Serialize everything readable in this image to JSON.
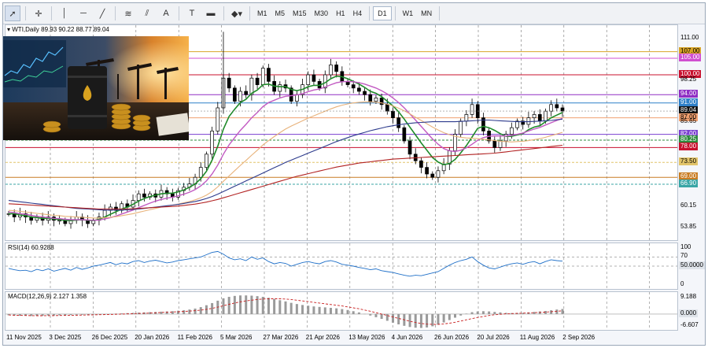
{
  "toolbar": {
    "tools": [
      {
        "name": "cursor-icon",
        "glyph": "➚",
        "selected": true
      },
      {
        "name": "crosshair-icon",
        "glyph": "✛",
        "selected": false
      },
      {
        "name": "vertical-line-icon",
        "glyph": "│",
        "selected": false
      },
      {
        "name": "horizontal-line-icon",
        "glyph": "─",
        "selected": false
      },
      {
        "name": "trend-line-icon",
        "glyph": "╱",
        "selected": false
      },
      {
        "name": "fibonacci-icon",
        "glyph": "≋",
        "selected": false
      },
      {
        "name": "channel-icon",
        "glyph": "⫽",
        "selected": false
      },
      {
        "name": "text-icon",
        "glyph": "A",
        "selected": false
      },
      {
        "name": "label-icon",
        "glyph": "T",
        "selected": false
      },
      {
        "name": "rectangle-icon",
        "glyph": "▬",
        "selected": false
      },
      {
        "name": "shapes-dropdown-icon",
        "glyph": "◆▾",
        "selected": false
      }
    ],
    "timeframes": [
      "M1",
      "M5",
      "M15",
      "M30",
      "H1",
      "H4",
      "D1",
      "W1",
      "MN"
    ],
    "selected_timeframe": "D1"
  },
  "chart": {
    "header": "WTI,Daily  89.93 90.22 88.77 89.04",
    "price_labels": [
      {
        "value": "111.00",
        "y": 111.0,
        "bg": "",
        "fg": "#000"
      },
      {
        "value": "107.00",
        "y": 107.0,
        "bg": "#d8a427",
        "fg": "#000"
      },
      {
        "value": "105.00",
        "y": 105.0,
        "bg": "#d04fd0",
        "fg": "#fff"
      },
      {
        "value": "100.00",
        "y": 100.0,
        "bg": "#c8102e",
        "fg": "#fff"
      },
      {
        "value": "98.25",
        "y": 98.25,
        "bg": "",
        "fg": "#000"
      },
      {
        "value": "94.00",
        "y": 94.0,
        "bg": "#8f2fc4",
        "fg": "#fff"
      },
      {
        "value": "91.00",
        "y": 91.5,
        "bg": "#2f80c8",
        "fg": "#fff"
      },
      {
        "value": "89.04",
        "y": 89.04,
        "bg": "#111111",
        "fg": "#fff"
      },
      {
        "value": "87.00",
        "y": 87.0,
        "bg": "#f0a070",
        "fg": "#000"
      },
      {
        "value": "85.65",
        "y": 85.65,
        "bg": "",
        "fg": "#000"
      },
      {
        "value": "82.00",
        "y": 82.0,
        "bg": "#7a3fd0",
        "fg": "#fff"
      },
      {
        "value": "80.25",
        "y": 80.25,
        "bg": "#2e8b3d",
        "fg": "#fff"
      },
      {
        "value": "78.00",
        "y": 78.0,
        "bg": "#c8102e",
        "fg": "#fff"
      },
      {
        "value": "73.50",
        "y": 73.5,
        "bg": "#e2c46a",
        "fg": "#000"
      },
      {
        "value": "69.00",
        "y": 69.0,
        "bg": "#c97d24",
        "fg": "#fff"
      },
      {
        "value": "66.90",
        "y": 66.9,
        "bg": "#3aa6a6",
        "fg": "#fff"
      },
      {
        "value": "60.15",
        "y": 60.15,
        "bg": "",
        "fg": "#000"
      },
      {
        "value": "53.85",
        "y": 53.85,
        "bg": "",
        "fg": "#000"
      }
    ],
    "levels": [
      {
        "y": 107.0,
        "color": "#d8a427",
        "style": "solid"
      },
      {
        "y": 105.0,
        "color": "#d04fd0",
        "style": "solid"
      },
      {
        "y": 100.0,
        "color": "#c8102e",
        "style": "solid"
      },
      {
        "y": 94.0,
        "color": "#8f2fc4",
        "style": "solid"
      },
      {
        "y": 91.5,
        "color": "#2f80c8",
        "style": "solid"
      },
      {
        "y": 87.0,
        "color": "#f0a070",
        "style": "solid"
      },
      {
        "y": 82.0,
        "color": "#7a3fd0",
        "style": "solid"
      },
      {
        "y": 80.25,
        "color": "#2e8b3d",
        "style": "dash"
      },
      {
        "y": 78.0,
        "color": "#c8102e",
        "style": "solid"
      },
      {
        "y": 73.5,
        "color": "#e2c46a",
        "style": "dash"
      },
      {
        "y": 69.0,
        "color": "#c97d24",
        "style": "solid"
      },
      {
        "y": 66.9,
        "color": "#3aa6a6",
        "style": "dash"
      }
    ],
    "x_labels": [
      "11 Nov 2025",
      "3 Dec 2025",
      "26 Dec 2025",
      "20 Jan 2026",
      "11 Feb 2026",
      "5 Mar 2026",
      "27 Mar 2026",
      "21 Apr 2026",
      "13 May 2026",
      "4 Jun 2026",
      "26 Jun 2026",
      "20 Jul 2026",
      "11 Aug 2026",
      "2 Sep 2026"
    ]
  },
  "chart_data": {
    "type": "line",
    "title": "WTI,Daily",
    "ylim": [
      50,
      115
    ],
    "ohlc": {
      "open": 89.93,
      "high": 90.22,
      "low": 88.77,
      "close": 89.04
    },
    "series": [
      {
        "name": "close",
        "values": [
          58,
          57,
          58,
          57,
          56,
          57,
          56,
          57,
          56,
          56,
          55,
          56,
          57,
          56,
          55,
          56,
          57,
          59,
          60,
          59,
          61,
          60,
          62,
          64,
          63,
          64,
          63,
          65,
          64,
          63,
          65,
          66,
          67,
          69,
          72,
          76,
          83,
          90,
          99,
          96,
          92,
          95,
          94,
          99,
          97,
          102,
          98,
          95,
          97,
          96,
          92,
          94,
          97,
          100,
          98,
          96,
          100,
          103,
          101,
          98,
          97,
          96,
          95,
          94,
          92,
          93,
          91,
          89,
          87,
          84,
          80,
          76,
          74,
          72,
          70,
          69,
          71,
          73,
          77,
          82,
          86,
          88,
          91,
          87,
          83,
          80,
          78,
          80,
          82,
          84,
          86,
          85,
          87,
          88,
          86,
          89,
          91,
          90,
          89.04
        ]
      },
      {
        "name": "ma-green",
        "values": [
          58,
          58,
          57.6,
          57.4,
          57,
          56.8,
          56.6,
          56.6,
          56.4,
          56.2,
          56,
          55.9,
          56.1,
          56.2,
          56,
          55.9,
          56.3,
          57,
          57.8,
          58.6,
          59.4,
          60,
          60.8,
          61.8,
          62.6,
          63.2,
          63.6,
          64,
          64.2,
          64.2,
          64.6,
          65.2,
          66,
          67,
          68.6,
          70.8,
          74.2,
          78.4,
          83.6,
          87.4,
          89.6,
          91.6,
          92.6,
          94.4,
          95.4,
          97,
          97.2,
          96.6,
          96.4,
          96.4,
          95.6,
          95.2,
          95.6,
          96.4,
          96.8,
          96.8,
          97.6,
          98.8,
          99.6,
          99.4,
          98.8,
          98,
          97.2,
          96.2,
          95,
          94.4,
          93.4,
          92,
          90.6,
          88.8,
          86.6,
          84.2,
          81.8,
          79.4,
          77.2,
          75,
          73.6,
          72.8,
          73.2,
          74.4,
          76.4,
          78.6,
          81.2,
          83.8,
          84.4,
          84,
          83.2,
          82.2,
          81.4,
          81.4,
          81.8,
          82.2,
          83.4,
          84.2,
          84.6,
          85.8,
          87,
          87.8,
          88.6
        ]
      },
      {
        "name": "ma-pink",
        "values": [
          58.5,
          58.3,
          58,
          57.8,
          57.5,
          57.2,
          57,
          56.8,
          56.6,
          56.5,
          56.3,
          56.2,
          56.2,
          56.2,
          56.1,
          56,
          56.1,
          56.4,
          56.8,
          57.3,
          57.9,
          58.5,
          59.1,
          59.8,
          60.5,
          61.2,
          61.8,
          62.3,
          62.7,
          63,
          63.4,
          63.9,
          64.5,
          65.3,
          66.4,
          67.9,
          70,
          72.7,
          76,
          78.8,
          81,
          83.2,
          85,
          87,
          88.6,
          90.4,
          91.6,
          92.3,
          93,
          93.5,
          93.7,
          93.9,
          94.3,
          94.9,
          95.4,
          95.7,
          96.3,
          97,
          97.6,
          97.9,
          98,
          97.9,
          97.6,
          97.2,
          96.6,
          96,
          95.2,
          94.2,
          93,
          91.6,
          90,
          88.2,
          86.3,
          84.4,
          82.5,
          80.6,
          79,
          77.7,
          77,
          76.8,
          77.2,
          77.9,
          79,
          80.2,
          81,
          81.4,
          81.5,
          81.5,
          81.5,
          81.7,
          82,
          82.4,
          83,
          83.6,
          84.1,
          84.8,
          85.5,
          86.2,
          86.8
        ]
      },
      {
        "name": "ma-tan",
        "values": [
          59,
          58.9,
          58.7,
          58.5,
          58.3,
          58.1,
          57.9,
          57.7,
          57.5,
          57.4,
          57.2,
          57.1,
          57,
          56.9,
          56.8,
          56.7,
          56.7,
          56.8,
          56.9,
          57.1,
          57.4,
          57.7,
          58,
          58.4,
          58.8,
          59.2,
          59.6,
          60,
          60.3,
          60.6,
          60.9,
          61.3,
          61.7,
          62.2,
          62.8,
          63.6,
          64.7,
          66.1,
          67.8,
          69.4,
          71,
          72.6,
          74.1,
          75.7,
          77.2,
          78.8,
          80.1,
          81.3,
          82.5,
          83.6,
          84.5,
          85.3,
          86.1,
          86.9,
          87.6,
          88.3,
          89,
          89.7,
          90.3,
          90.8,
          91.2,
          91.5,
          91.7,
          91.8,
          91.8,
          91.7,
          91.5,
          91.1,
          90.6,
          89.9,
          89.1,
          88.2,
          87.2,
          86.2,
          85.2,
          84.2,
          83.3,
          82.5,
          81.9,
          81.4,
          81.1,
          80.9,
          80.8,
          80.7,
          80.5,
          80.3,
          80.1,
          79.9,
          79.8,
          79.7,
          79.8,
          79.9,
          80.1,
          80.4,
          80.7,
          81.1,
          81.6,
          82.1,
          82.6
        ]
      },
      {
        "name": "ma-navy",
        "values": [
          62,
          61.8,
          61.6,
          61.4,
          61.2,
          61,
          60.8,
          60.6,
          60.4,
          60.2,
          60,
          59.8,
          59.6,
          59.5,
          59.4,
          59.3,
          59.2,
          59.1,
          59.1,
          59.1,
          59.1,
          59.2,
          59.3,
          59.4,
          59.6,
          59.8,
          60,
          60.2,
          60.4,
          60.6,
          60.8,
          61.1,
          61.4,
          61.7,
          62.1,
          62.6,
          63.2,
          63.9,
          64.7,
          65.5,
          66.3,
          67.1,
          67.9,
          68.7,
          69.5,
          70.3,
          71.1,
          71.9,
          72.7,
          73.5,
          74.2,
          74.9,
          75.6,
          76.3,
          77,
          77.7,
          78.4,
          79.1,
          79.8,
          80.4,
          81,
          81.6,
          82.1,
          82.6,
          83.1,
          83.5,
          83.9,
          84.3,
          84.6,
          84.9,
          85.1,
          85.3,
          85.5,
          85.6,
          85.7,
          85.8,
          85.8,
          85.8,
          85.8,
          85.8,
          85.9,
          86,
          86.1,
          86.2,
          86.3,
          86.3,
          86.2,
          86.1,
          86,
          85.9,
          85.8,
          85.8,
          85.8,
          85.9,
          86,
          86.1,
          86.2,
          86.4,
          86.6
        ]
      },
      {
        "name": "ma-red",
        "values": [
          61,
          60.9,
          60.8,
          60.7,
          60.6,
          60.5,
          60.4,
          60.3,
          60.2,
          60.1,
          60,
          59.9,
          59.8,
          59.7,
          59.6,
          59.5,
          59.4,
          59.4,
          59.4,
          59.4,
          59.4,
          59.4,
          59.5,
          59.6,
          59.7,
          59.8,
          59.9,
          60,
          60.1,
          60.2,
          60.3,
          60.5,
          60.7,
          60.9,
          61.2,
          61.5,
          61.9,
          62.3,
          62.8,
          63.3,
          63.8,
          64.3,
          64.8,
          65.3,
          65.8,
          66.3,
          66.8,
          67.3,
          67.8,
          68.3,
          68.8,
          69.3,
          69.7,
          70.1,
          70.5,
          70.9,
          71.3,
          71.7,
          72.1,
          72.4,
          72.7,
          73,
          73.3,
          73.5,
          73.7,
          73.9,
          74.1,
          74.3,
          74.5,
          74.6,
          74.7,
          74.8,
          74.9,
          75,
          75.1,
          75.2,
          75.3,
          75.4,
          75.5,
          75.6,
          75.7,
          75.8,
          75.9,
          76,
          76.1,
          76.2,
          76.3,
          76.5,
          76.7,
          76.9,
          77.1,
          77.3,
          77.5,
          77.7,
          77.9,
          78.1,
          78.3,
          78.5,
          78.7
        ]
      }
    ],
    "rsi": {
      "label": "RSI(14) 60.9288",
      "levels_text": [
        "100",
        "70",
        "50.0000",
        "0"
      ],
      "value_label": "50.0000",
      "values": [
        45,
        42,
        40,
        41,
        38,
        43,
        40,
        44,
        39,
        42,
        45,
        41,
        47,
        43,
        46,
        50,
        52,
        55,
        58,
        53,
        57,
        55,
        60,
        62,
        58,
        61,
        63,
        60,
        57,
        59,
        62,
        64,
        66,
        68,
        70,
        75,
        80,
        82,
        76,
        68,
        64,
        66,
        62,
        70,
        65,
        68,
        60,
        55,
        58,
        56,
        50,
        54,
        58,
        60,
        57,
        55,
        60,
        62,
        59,
        54,
        52,
        50,
        47,
        45,
        42,
        44,
        40,
        38,
        36,
        33,
        30,
        28,
        30,
        29,
        32,
        35,
        38,
        45,
        52,
        58,
        62,
        65,
        70,
        60,
        52,
        46,
        44,
        48,
        52,
        55,
        57,
        54,
        58,
        60,
        55,
        60,
        64,
        62,
        60.93
      ]
    },
    "macd": {
      "label": "MACD(12,26,9) 2.127 1.358",
      "top_label": "9.188",
      "zero_label": "0.000",
      "bottom_label": "-6.607",
      "histogram": [
        -0.5,
        -0.6,
        -0.7,
        -0.7,
        -0.8,
        -0.7,
        -0.7,
        -0.6,
        -0.6,
        -0.5,
        -0.5,
        -0.4,
        -0.3,
        -0.3,
        -0.2,
        -0.2,
        -0.1,
        0,
        0.1,
        0.2,
        0.3,
        0.4,
        0.5,
        0.6,
        0.7,
        0.8,
        0.9,
        1,
        1.1,
        1.2,
        1.4,
        1.6,
        1.9,
        2.3,
        2.9,
        3.7,
        4.6,
        5.6,
        6.6,
        7.2,
        7.6,
        7.8,
        7.8,
        7.7,
        7.5,
        7.2,
        6.8,
        6.3,
        5.8,
        5.3,
        4.7,
        4.2,
        3.8,
        3.5,
        3.2,
        3,
        2.8,
        2.6,
        2.4,
        2.1,
        1.7,
        1.2,
        0.7,
        0.1,
        -0.6,
        -1.3,
        -2,
        -2.8,
        -3.6,
        -4.3,
        -4.9,
        -5.4,
        -5.7,
        -5.8,
        -5.6,
        -5.1,
        -4.4,
        -3.5,
        -2.5,
        -1.5,
        -0.6,
        0.2,
        0.8,
        1.1,
        1.2,
        1.1,
        0.9,
        0.7,
        0.5,
        0.4,
        0.4,
        0.5,
        0.7,
        0.9,
        1.1,
        1.3,
        1.6,
        1.9,
        2.13
      ],
      "signal": [
        -0.4,
        -0.5,
        -0.55,
        -0.6,
        -0.65,
        -0.67,
        -0.68,
        -0.66,
        -0.64,
        -0.6,
        -0.56,
        -0.52,
        -0.47,
        -0.42,
        -0.37,
        -0.32,
        -0.27,
        -0.21,
        -0.15,
        -0.08,
        0,
        0.08,
        0.17,
        0.26,
        0.35,
        0.45,
        0.55,
        0.65,
        0.75,
        0.86,
        0.97,
        1.1,
        1.25,
        1.43,
        1.66,
        1.98,
        2.4,
        2.9,
        3.5,
        4.1,
        4.6,
        5.1,
        5.5,
        5.8,
        6.1,
        6.3,
        6.4,
        6.4,
        6.4,
        6.3,
        6.1,
        5.8,
        5.5,
        5.2,
        4.9,
        4.6,
        4.3,
        4,
        3.7,
        3.4,
        3,
        2.6,
        2.2,
        1.7,
        1.2,
        0.6,
        0,
        -0.6,
        -1.2,
        -1.8,
        -2.4,
        -3,
        -3.5,
        -3.9,
        -4.2,
        -4.3,
        -4.3,
        -4.1,
        -3.8,
        -3.4,
        -2.9,
        -2.4,
        -1.9,
        -1.4,
        -1,
        -0.6,
        -0.3,
        -0.1,
        0.1,
        0.2,
        0.3,
        0.4,
        0.5,
        0.6,
        0.7,
        0.8,
        1,
        1.2,
        1.36
      ]
    }
  }
}
